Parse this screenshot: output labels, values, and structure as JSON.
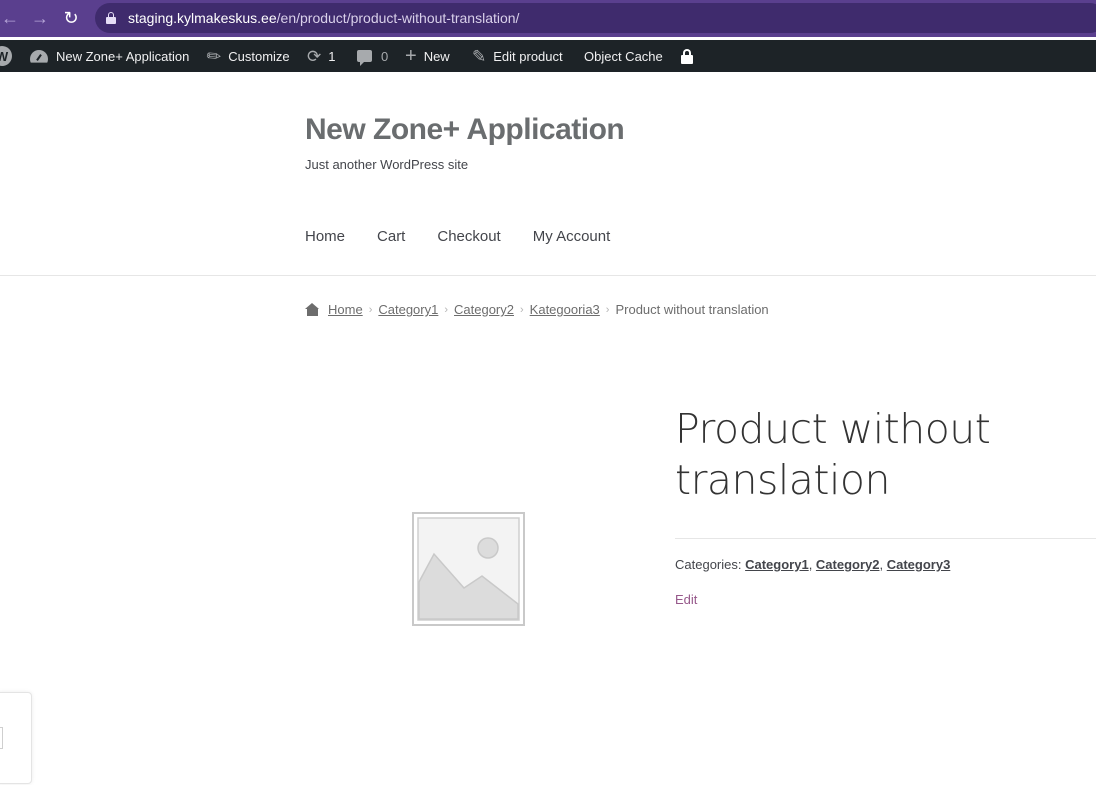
{
  "browser": {
    "url_host": "staging.kylmakeskus.ee",
    "url_path": "/en/product/product-without-translation/",
    "theme_color": "#5a3f8e"
  },
  "admin_bar": {
    "site_name": "New Zone+ Application",
    "customize": "Customize",
    "updates_count": "1",
    "comments_count": "0",
    "new": "New",
    "edit_product": "Edit product",
    "object_cache": "Object Cache"
  },
  "site": {
    "title": "New Zone+ Application",
    "tagline": "Just another WordPress site"
  },
  "nav": {
    "items": [
      "Home",
      "Cart",
      "Checkout",
      "My Account"
    ]
  },
  "breadcrumb": {
    "items": [
      "Home",
      "Category1",
      "Category2",
      "Kategooria3"
    ],
    "current": "Product without translation"
  },
  "product": {
    "title": "Product without translation",
    "categories_label": "Categories:",
    "categories": [
      "Category1",
      "Category2",
      "Category3"
    ],
    "edit": "Edit",
    "accent_color": "#96588a"
  }
}
